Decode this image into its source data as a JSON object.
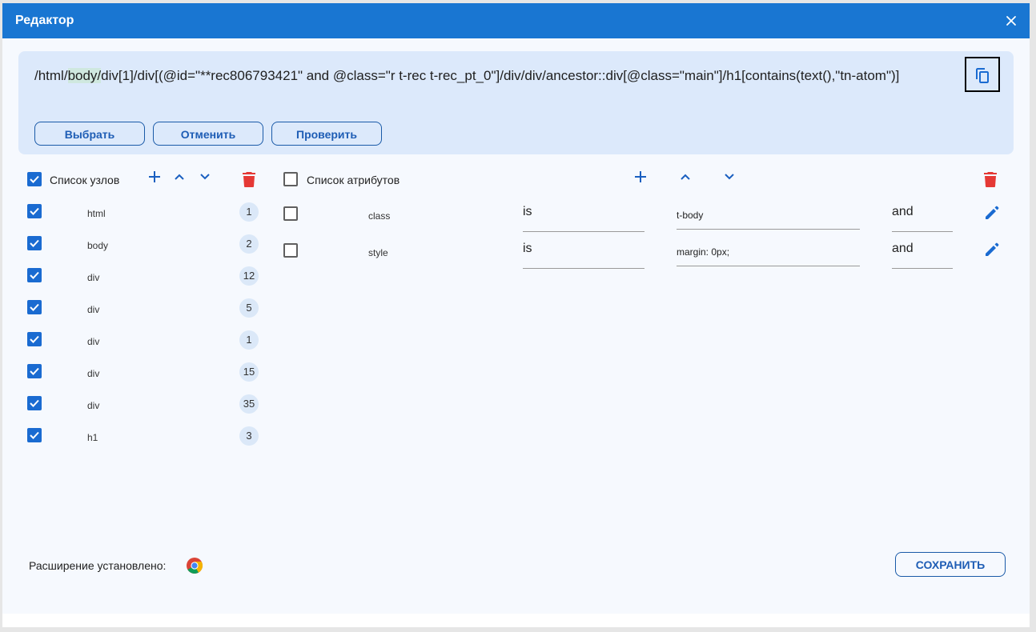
{
  "dialog": {
    "title": "Редактор"
  },
  "xpath": {
    "prefix": "/html/",
    "highlight": "body/",
    "suffix": "div[1]/div[(@id=\"**rec806793421\" and @class=\"r t-rec t-rec_pt_0\"]/div/div/ancestor::div[@class=\"main\"]/h1[contains(text(),\"tn-atom\")]"
  },
  "actions": {
    "select": "Выбрать",
    "cancel": "Отменить",
    "check": "Проверить"
  },
  "nodes": {
    "header": "Список узлов",
    "items": [
      {
        "name": "html",
        "count": "1"
      },
      {
        "name": "body",
        "count": "2"
      },
      {
        "name": "div",
        "count": "12"
      },
      {
        "name": "div",
        "count": "5"
      },
      {
        "name": "div",
        "count": "1"
      },
      {
        "name": "div",
        "count": "15"
      },
      {
        "name": "div",
        "count": "35"
      },
      {
        "name": "h1",
        "count": "3"
      }
    ]
  },
  "attributes": {
    "header": "Список атрибутов",
    "items": [
      {
        "name": "class",
        "operator": "is",
        "value": "t-body",
        "logic": "and"
      },
      {
        "name": "style",
        "operator": "is",
        "value": "margin: 0px;",
        "logic": "and"
      }
    ]
  },
  "footer": {
    "extension_label": "Расширение установлено:",
    "save": "СОХРАНИТЬ"
  },
  "colors": {
    "primary": "#1976d2",
    "accent": "#1a6bd1",
    "delete": "#e53935",
    "panel": "#dce9fb"
  }
}
